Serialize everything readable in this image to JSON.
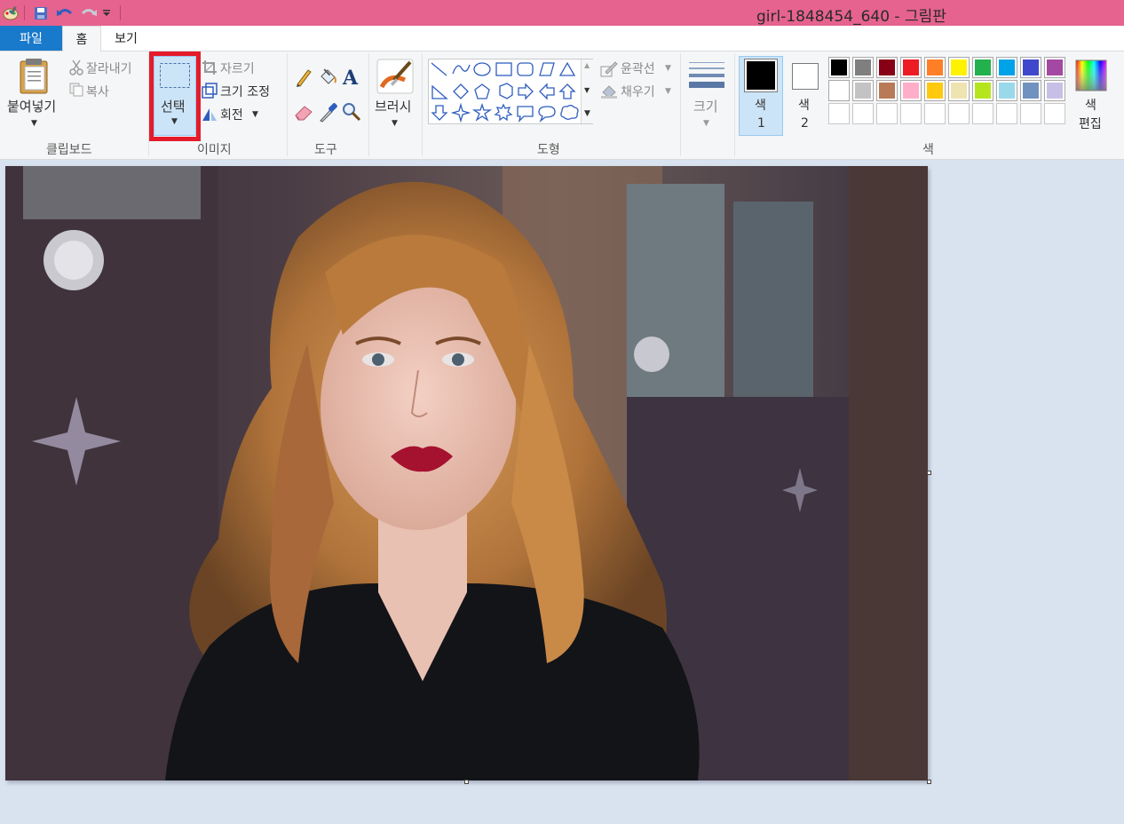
{
  "window": {
    "title": "girl-1848454_640 - 그림판"
  },
  "tabs": {
    "file": "파일",
    "home": "홈",
    "view": "보기"
  },
  "clipboard": {
    "paste": "붙여넣기",
    "cut": "잘라내기",
    "copy": "복사",
    "group_label": "클립보드"
  },
  "image": {
    "select": "선택",
    "crop": "자르기",
    "resize": "크기 조정",
    "rotate": "회전",
    "group_label": "이미지"
  },
  "tools": {
    "group_label": "도구",
    "items": [
      "pencil-icon",
      "fill-bucket-icon",
      "text-icon",
      "eraser-icon",
      "color-picker-icon",
      "magnifier-icon"
    ]
  },
  "brushes": {
    "label": "브러시"
  },
  "shapes": {
    "outline": "윤곽선",
    "fill": "채우기",
    "group_label": "도형"
  },
  "size": {
    "label": "크기"
  },
  "colors": {
    "color1_label": "색",
    "color1_num": "1",
    "color2_label": "색",
    "color2_num": "2",
    "edit_label_1": "색",
    "edit_label_2": "편집",
    "group_label": "색",
    "color1": "#000000",
    "color2": "#ffffff",
    "palette_row1": [
      "#000000",
      "#7f7f7f",
      "#880015",
      "#ed1c24",
      "#ff7f27",
      "#fff200",
      "#22b14c",
      "#00a2e8",
      "#3f48cc",
      "#a349a4"
    ],
    "palette_row2": [
      "#ffffff",
      "#c3c3c3",
      "#b97a57",
      "#ffaec9",
      "#ffc90e",
      "#efe4b0",
      "#b5e61d",
      "#99d9ea",
      "#7092be",
      "#c8bfe7"
    ],
    "palette_row3": [
      "",
      "",
      "",
      "",
      "",
      "",
      "",
      "",
      "",
      ""
    ]
  },
  "theme": {
    "titlebar": "#e5638e",
    "file_tab": "#1979ca",
    "highlight": "#e41b2a"
  }
}
